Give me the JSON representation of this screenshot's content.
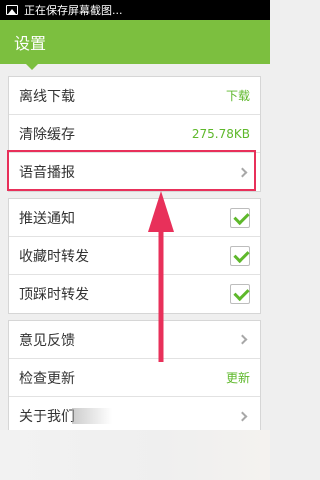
{
  "status_bar": {
    "text": "正在保存屏幕截图..."
  },
  "header": {
    "title": "设置"
  },
  "group1": [
    {
      "label": "离线下载",
      "value": "下载"
    },
    {
      "label": "清除缓存",
      "value": "275.78KB"
    },
    {
      "label": "语音播报"
    }
  ],
  "group2": [
    {
      "label": "推送通知",
      "checked": true
    },
    {
      "label": "收藏时转发",
      "checked": true
    },
    {
      "label": "顶踩时转发",
      "checked": true
    }
  ],
  "group3": [
    {
      "label": "意见反馈"
    },
    {
      "label": "检查更新",
      "value": "更新"
    },
    {
      "label": "关于我们"
    }
  ],
  "colors": {
    "accent": "#7cbf3f",
    "highlight": "#e8305a",
    "value_text": "#5eb82b"
  }
}
